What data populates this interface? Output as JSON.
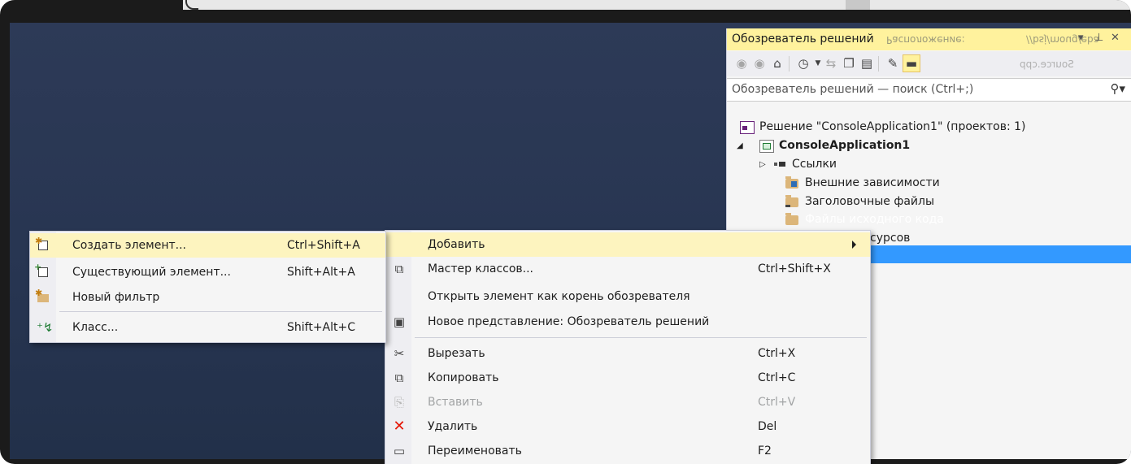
{
  "solution_explorer": {
    "title": "Обозреватель решений",
    "ghost_text_1": "Расположение:",
    "ghost_text_2": "//bsj/moug/eba",
    "ghost_text_3": "Source.cpp",
    "search_placeholder": "Обозреватель решений — поиск (Ctrl+;)",
    "tree": {
      "solution": "Решение \"ConsoleApplication1\"  (проектов: 1)",
      "project": "ConsoleApplication1",
      "refs": "Ссылки",
      "external": "Внешние зависимости",
      "headers": "Заголовочные файлы",
      "sources": "Файлы исходного кода",
      "resources_tail": "сурсов"
    }
  },
  "context_menu": {
    "items": [
      {
        "label": "Добавить",
        "shortcut": ""
      },
      {
        "label": "Мастер классов...",
        "shortcut": "Ctrl+Shift+X"
      },
      {
        "label": "Открыть элемент как корень обозревателя",
        "shortcut": ""
      },
      {
        "label": "Новое представление: Обозреватель решений",
        "shortcut": ""
      },
      {
        "label": "Вырезать",
        "shortcut": "Ctrl+X"
      },
      {
        "label": "Копировать",
        "shortcut": "Ctrl+C"
      },
      {
        "label": "Вставить",
        "shortcut": "Ctrl+V"
      },
      {
        "label": "Удалить",
        "shortcut": "Del"
      },
      {
        "label": "Переименовать",
        "shortcut": "F2"
      }
    ]
  },
  "submenu": {
    "items": [
      {
        "label": "Создать элемент...",
        "shortcut": "Ctrl+Shift+A"
      },
      {
        "label": "Существующий элемент...",
        "shortcut": "Shift+Alt+A"
      },
      {
        "label": "Новый фильтр",
        "shortcut": ""
      },
      {
        "label": "Класс...",
        "shortcut": "Shift+Alt+C"
      }
    ]
  },
  "colors": {
    "editor_background": "#293754",
    "highlight": "#fdf4bf",
    "selection": "#3399ff",
    "title_active": "#fff29d"
  }
}
